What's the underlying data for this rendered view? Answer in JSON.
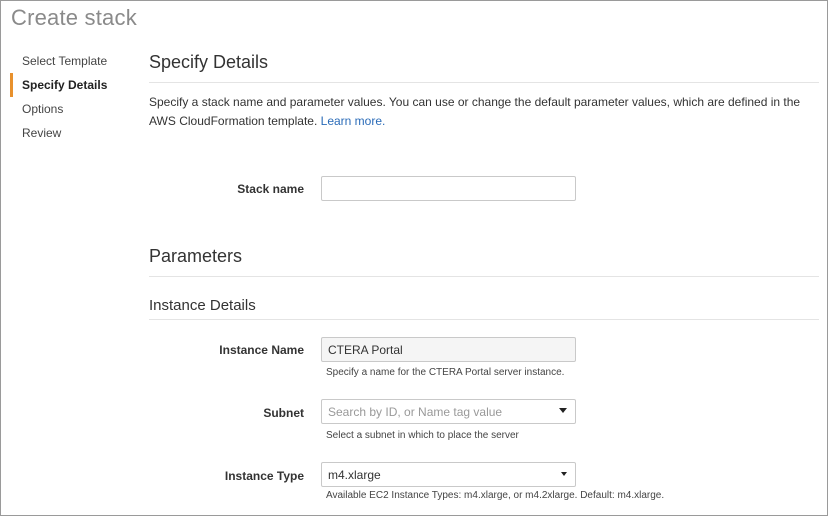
{
  "page": {
    "title": "Create stack"
  },
  "nav": {
    "items": [
      {
        "label": "Select Template",
        "active": false
      },
      {
        "label": "Specify Details",
        "active": true
      },
      {
        "label": "Options",
        "active": false
      },
      {
        "label": "Review",
        "active": false
      }
    ]
  },
  "details": {
    "heading": "Specify Details",
    "description": "Specify a stack name and parameter values. You can use or change the default parameter values, which are defined in the AWS CloudFormation template.",
    "learn_more": "Learn more."
  },
  "stack_name": {
    "label": "Stack name",
    "value": "",
    "placeholder": ""
  },
  "parameters": {
    "heading": "Parameters",
    "instance_details_heading": "Instance Details",
    "instance_name": {
      "label": "Instance Name",
      "value": "CTERA Portal",
      "help": "Specify a name for the CTERA Portal server instance."
    },
    "subnet": {
      "label": "Subnet",
      "placeholder": "Search by ID, or Name tag value",
      "help": "Select a subnet in which to place the server"
    },
    "instance_type": {
      "label": "Instance Type",
      "value": "m4.xlarge",
      "help": "Available EC2 Instance Types: m4.xlarge, or m4.2xlarge. Default: m4.xlarge."
    }
  },
  "colors": {
    "accent": "#e8912d",
    "link": "#2a6bb8"
  },
  "icons": {
    "dropdown": "caret-down-icon"
  }
}
